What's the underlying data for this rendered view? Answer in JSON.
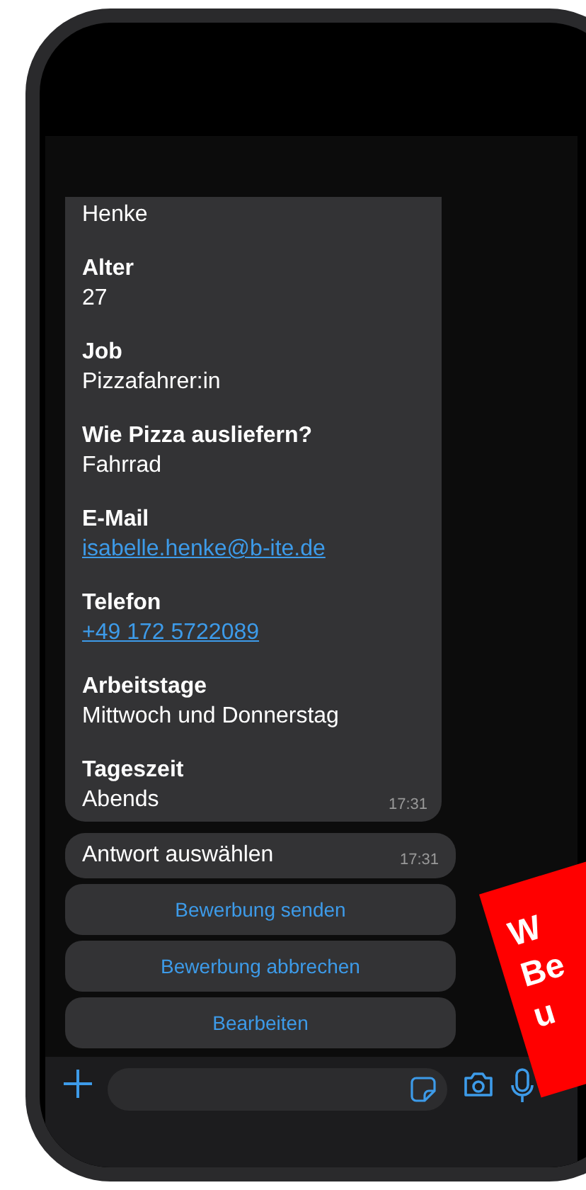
{
  "message": {
    "fields": [
      {
        "value": "Henke",
        "kind": "text"
      },
      {
        "label": "Alter",
        "value": "27",
        "kind": "text"
      },
      {
        "label": "Job",
        "value": "Pizzafahrer:in",
        "kind": "text"
      },
      {
        "label": "Wie Pizza ausliefern?",
        "value": "Fahrrad",
        "kind": "text"
      },
      {
        "label": "E-Mail",
        "value": "isabelle.henke@b-ite.de",
        "kind": "link"
      },
      {
        "label": "Telefon",
        "value": "+49 172 5722089",
        "kind": "link"
      },
      {
        "label": "Arbeitstage",
        "value": "Mittwoch und Donnerstag",
        "kind": "text"
      },
      {
        "label": "Tageszeit",
        "value": "Abends",
        "kind": "text"
      }
    ],
    "time": "17:31"
  },
  "prompt": {
    "text": "Antwort auswählen",
    "time": "17:31"
  },
  "replies": [
    "Bewerbung senden",
    "Bewerbung abbrechen",
    "Bearbeiten"
  ],
  "sticker": {
    "lines": [
      "W",
      "Be",
      "u"
    ]
  }
}
